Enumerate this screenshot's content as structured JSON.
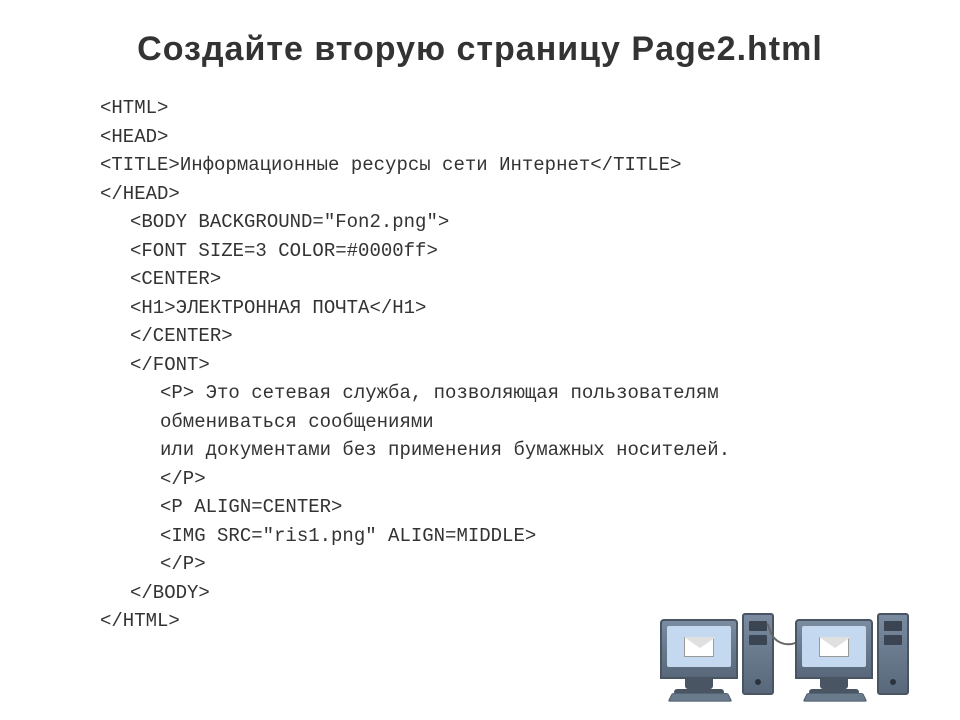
{
  "title": "Создайте вторую страницу Page2.html",
  "code": {
    "lines": [
      {
        "indent": 0,
        "text": "<HTML>"
      },
      {
        "indent": 0,
        "text": "<HEAD>"
      },
      {
        "indent": 0,
        "text": "<TITLE>Информационные ресурсы сети Интернет</TITLE>"
      },
      {
        "indent": 0,
        "text": "</HEAD>"
      },
      {
        "indent": 1,
        "text": "<BODY BACKGROUND=\"Fon2.png\">"
      },
      {
        "indent": 1,
        "text": "<FONT SIZE=3 COLOR=#0000ff>"
      },
      {
        "indent": 1,
        "text": "<CENTER>"
      },
      {
        "indent": 1,
        "text": "<H1>ЭЛЕКТРОННАЯ ПОЧТА</H1>"
      },
      {
        "indent": 1,
        "text": "</CENTER>"
      },
      {
        "indent": 1,
        "text": "</FONT>"
      },
      {
        "indent": 2,
        "text": "<P> Это сетевая служба, позволяющая пользователям"
      },
      {
        "indent": 2,
        "text": "обмениваться сообщениями"
      },
      {
        "indent": 2,
        "text": "или документами без применения бумажных носителей."
      },
      {
        "indent": 2,
        "text": "</P>"
      },
      {
        "indent": 2,
        "text": "<P ALIGN=CENTER>"
      },
      {
        "indent": 2,
        "text": "<IMG SRC=\"ris1.png\" ALIGN=MIDDLE>"
      },
      {
        "indent": 2,
        "text": "</P>"
      },
      {
        "indent": 1,
        "text": "</BODY>"
      },
      {
        "indent": 0,
        "text": "</HTML>"
      }
    ]
  }
}
